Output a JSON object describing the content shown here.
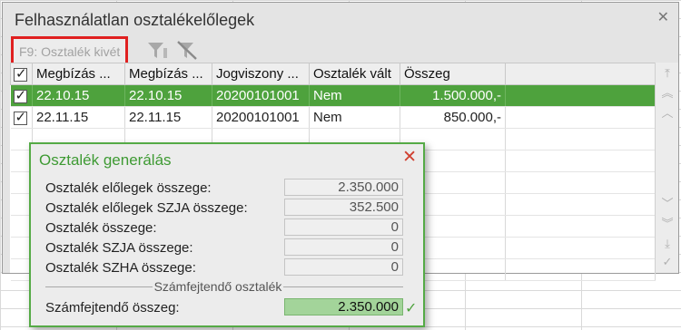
{
  "window": {
    "title": "Felhasználatlan osztalékelőlegek"
  },
  "toolbar": {
    "payout_label": "F9: Osztalék kivét",
    "icons": [
      "filter-icon",
      "filter-clear-icon"
    ]
  },
  "grid": {
    "columns": [
      "Megbízás ...",
      "Megbízás ...",
      "Jogviszony ...",
      "Osztalék vált",
      "Összeg"
    ],
    "rows": [
      {
        "col1": "22.10.15",
        "col2": "22.10.15",
        "col3": "20200101001",
        "col4": "Nem",
        "amount": "1.500.000,-",
        "checked": true,
        "selected": true
      },
      {
        "col1": "22.11.15",
        "col2": "22.11.15",
        "col3": "20200101001",
        "col4": "Nem",
        "amount": "850.000,-",
        "checked": true,
        "selected": false
      }
    ],
    "selected_color": "#4ea23d"
  },
  "dialog": {
    "title": "Osztalék generálás",
    "fields": [
      {
        "label": "Osztalék előlegek összege:",
        "value": "2.350.000"
      },
      {
        "label": "Osztalék előlegek SZJA összege:",
        "value": "352.500"
      },
      {
        "label": "Osztalék összege:",
        "value": "0"
      },
      {
        "label": "Osztalék SZJA összege:",
        "value": "0"
      },
      {
        "label": "Osztalék SZHA összege:",
        "value": "0"
      }
    ],
    "section_title": "Számfejtendő osztalék",
    "total": {
      "label": "Számfejtendő összeg:",
      "value": "2.350.000"
    },
    "accent_color": "#3e9a33"
  }
}
